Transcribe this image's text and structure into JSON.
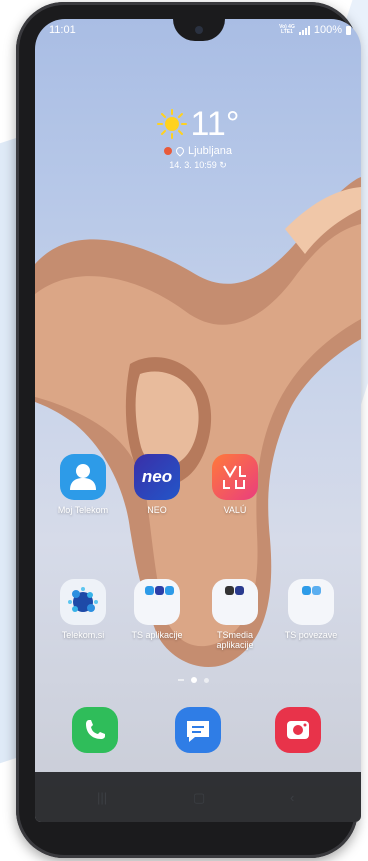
{
  "status_bar": {
    "time": "11:01",
    "network_top": "Vo) 4G",
    "network_bottom": "LTE1",
    "battery": "100%"
  },
  "weather": {
    "temperature": "11°",
    "location": "Ljubljana",
    "updated": "14. 3. 10:59"
  },
  "apps_row1": [
    {
      "label": "Moj Telekom",
      "icon": "person-icon"
    },
    {
      "label": "NEO",
      "icon": "neo-logo-icon",
      "logo_text": "neo"
    },
    {
      "label": "VALÚ",
      "icon": "valu-logo-icon"
    }
  ],
  "apps_row2": [
    {
      "label": "Telekom.si",
      "icon": "telekom-si-icon"
    },
    {
      "label": "TS aplikacije",
      "icon": "folder-icon"
    },
    {
      "label": "TSmedia aplikacije",
      "icon": "folder-icon"
    },
    {
      "label": "TS povezave",
      "icon": "folder-icon"
    }
  ],
  "dock": [
    {
      "name": "phone",
      "icon": "phone-icon",
      "color": "#2fbd5a"
    },
    {
      "name": "messages",
      "icon": "message-icon",
      "color": "#2f7de6"
    },
    {
      "name": "camera",
      "icon": "camera-icon",
      "color": "#e8334a"
    }
  ],
  "colors": {
    "moj_telekom": "#2d9be8",
    "neo": "#2b3ea8",
    "valu": "#f04a5a"
  }
}
